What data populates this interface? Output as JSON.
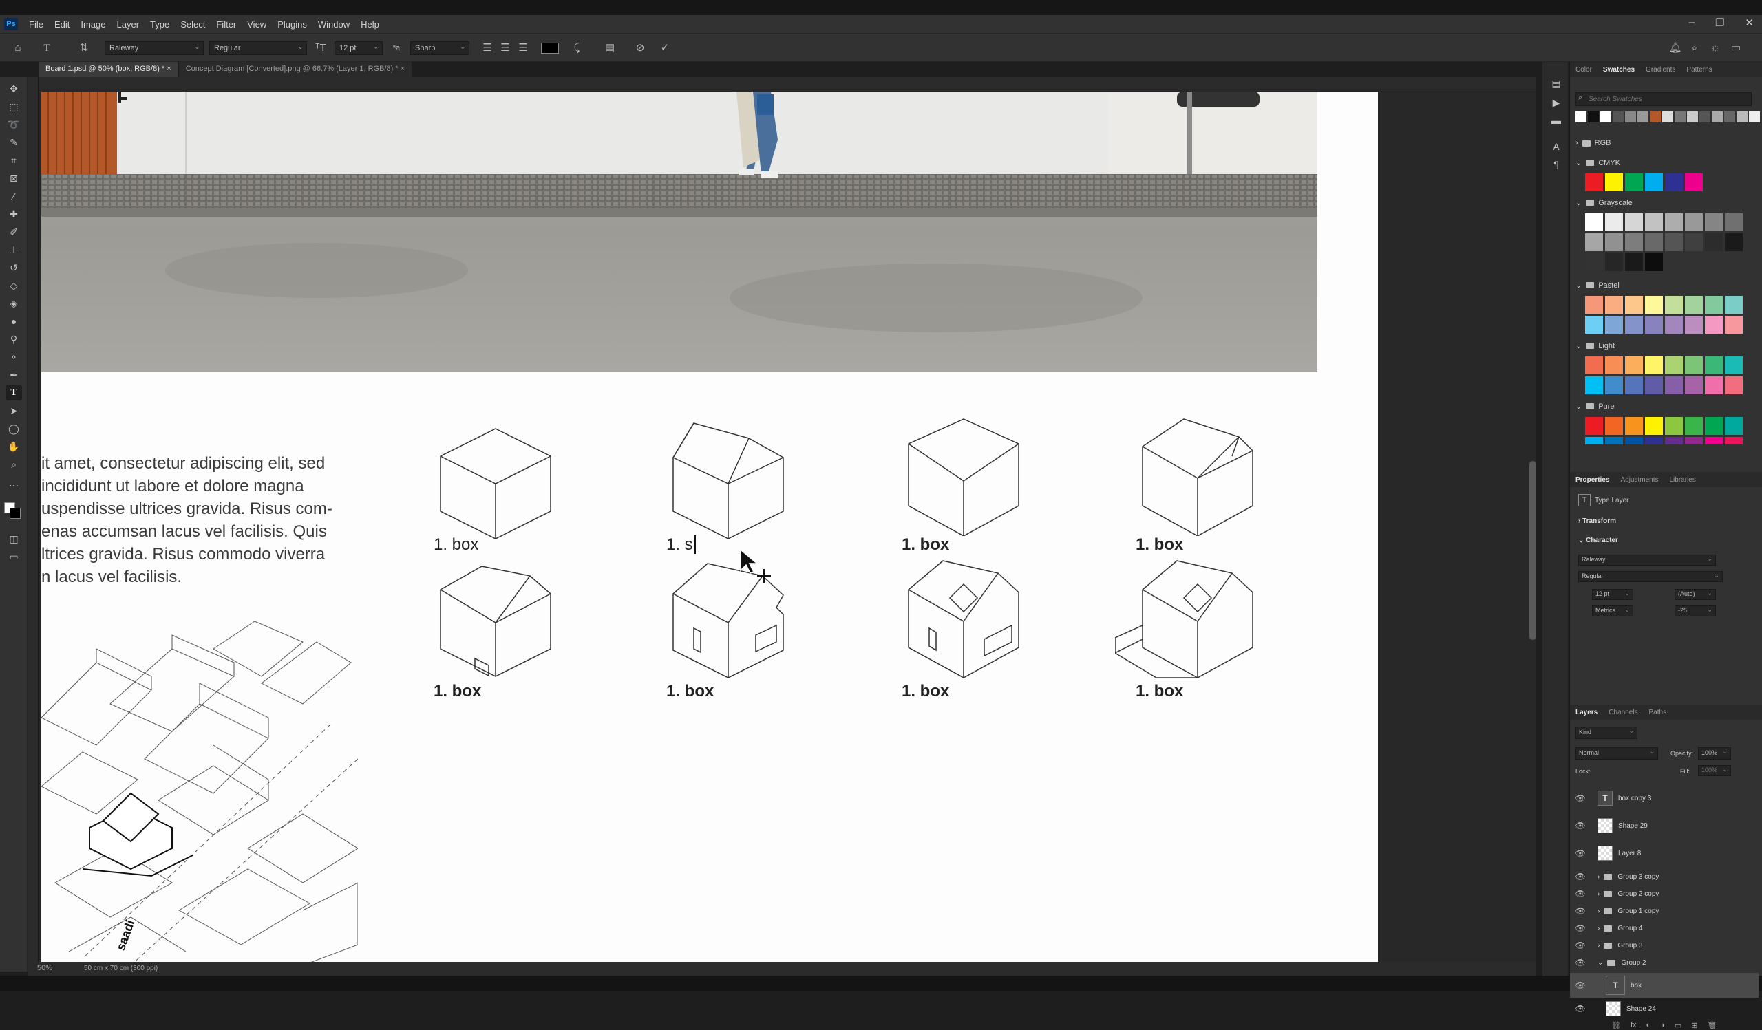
{
  "app": {
    "logo": "Ps",
    "menu": [
      "File",
      "Edit",
      "Image",
      "Layer",
      "Type",
      "Select",
      "Filter",
      "View",
      "Plugins",
      "Window",
      "Help"
    ]
  },
  "options_bar": {
    "font_family": "Raleway",
    "font_style": "Regular",
    "font_size": "12 pt",
    "anti_alias": "Sharp",
    "text_color": "#000000"
  },
  "tabs": [
    {
      "label": "Board 1.psd @ 50% (box, RGB/8) *",
      "active": true
    },
    {
      "label": "Concept Diagram [Converted].png @ 66.7% (Layer 1, RGB/8) *",
      "active": false
    }
  ],
  "canvas": {
    "body_text": [
      "it amet, consectetur adipiscing elit, sed",
      "incididunt ut labore et dolore magna",
      "uspendisse ultrices gravida. Risus com-",
      "enas accumsan lacus vel facilisis. Quis",
      "ltrices gravida. Risus commodo viverra",
      "n lacus vel facilisis."
    ],
    "box_labels_row1": [
      "1. box",
      "1. s",
      "1. box",
      "1. box"
    ],
    "box_labels_row2": [
      "1. box",
      "1. box",
      "1. box",
      "1. box"
    ],
    "map_label": "saadi"
  },
  "status": {
    "zoom": "50%",
    "doc_size": "50 cm x 70 cm (300 ppi)"
  },
  "panels": {
    "swatch_tabs": [
      "Color",
      "Swatches",
      "Gradients",
      "Patterns"
    ],
    "search_placeholder": "Search Swatches",
    "groups": [
      "RGB",
      "CMYK",
      "Grayscale",
      "Pastel",
      "Light",
      "Pure"
    ],
    "properties_tabs": [
      "Properties",
      "Adjustments",
      "Libraries"
    ],
    "type_layer": "Type Layer",
    "transform": "Transform",
    "character": "Character",
    "char_font": "Raleway",
    "char_style": "Regular",
    "char_size": "12 pt",
    "leading": "(Auto)",
    "kerning": "Metrics",
    "tracking": "-25",
    "layers_tabs": [
      "Layers",
      "Channels",
      "Paths"
    ],
    "kind": "Kind",
    "blend": "Normal",
    "opacity_label": "Opacity:",
    "opacity": "100%",
    "lock_label": "Lock:",
    "fill_label": "Fill:",
    "fill": "100%",
    "layers": [
      "box copy 3",
      "Shape 29",
      "Layer 8",
      "Group 3 copy",
      "Group 2 copy",
      "Group 1 copy",
      "Group 4",
      "Group 3",
      "Group 2",
      "box",
      "Shape 24"
    ]
  },
  "colors": {
    "accent_selection": "#4a4a4a",
    "ps_blue": "#31a8ff"
  }
}
